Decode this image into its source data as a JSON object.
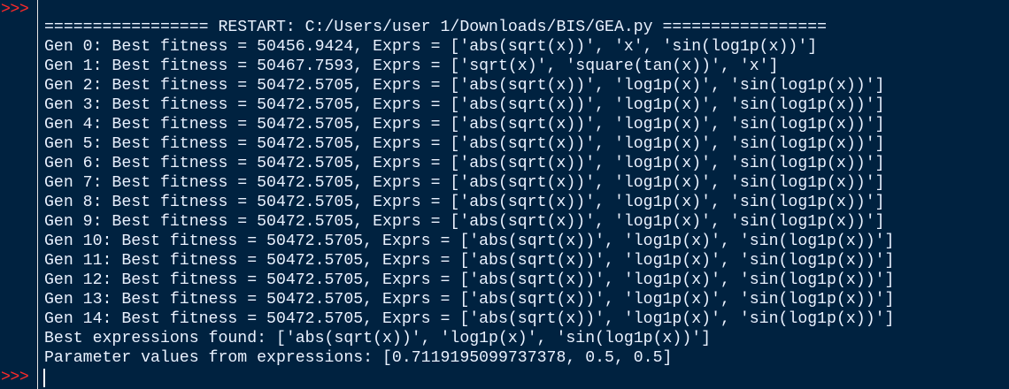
{
  "shell": {
    "prompt_symbol": ">>>",
    "output_lines": [
      "================= RESTART: C:/Users/user 1/Downloads/BIS/GEA.py =================",
      "Gen 0: Best fitness = 50456.9424, Exprs = ['abs(sqrt(x))', 'x', 'sin(log1p(x))']",
      "Gen 1: Best fitness = 50467.7593, Exprs = ['sqrt(x)', 'square(tan(x))', 'x']",
      "Gen 2: Best fitness = 50472.5705, Exprs = ['abs(sqrt(x))', 'log1p(x)', 'sin(log1p(x))']",
      "Gen 3: Best fitness = 50472.5705, Exprs = ['abs(sqrt(x))', 'log1p(x)', 'sin(log1p(x))']",
      "Gen 4: Best fitness = 50472.5705, Exprs = ['abs(sqrt(x))', 'log1p(x)', 'sin(log1p(x))']",
      "Gen 5: Best fitness = 50472.5705, Exprs = ['abs(sqrt(x))', 'log1p(x)', 'sin(log1p(x))']",
      "Gen 6: Best fitness = 50472.5705, Exprs = ['abs(sqrt(x))', 'log1p(x)', 'sin(log1p(x))']",
      "Gen 7: Best fitness = 50472.5705, Exprs = ['abs(sqrt(x))', 'log1p(x)', 'sin(log1p(x))']",
      "Gen 8: Best fitness = 50472.5705, Exprs = ['abs(sqrt(x))', 'log1p(x)', 'sin(log1p(x))']",
      "Gen 9: Best fitness = 50472.5705, Exprs = ['abs(sqrt(x))', 'log1p(x)', 'sin(log1p(x))']",
      "Gen 10: Best fitness = 50472.5705, Exprs = ['abs(sqrt(x))', 'log1p(x)', 'sin(log1p(x))']",
      "Gen 11: Best fitness = 50472.5705, Exprs = ['abs(sqrt(x))', 'log1p(x)', 'sin(log1p(x))']",
      "Gen 12: Best fitness = 50472.5705, Exprs = ['abs(sqrt(x))', 'log1p(x)', 'sin(log1p(x))']",
      "Gen 13: Best fitness = 50472.5705, Exprs = ['abs(sqrt(x))', 'log1p(x)', 'sin(log1p(x))']",
      "Gen 14: Best fitness = 50472.5705, Exprs = ['abs(sqrt(x))', 'log1p(x)', 'sin(log1p(x))']",
      "Best expressions found: ['abs(sqrt(x))', 'log1p(x)', 'sin(log1p(x))']",
      "Parameter values from expressions: [0.7119195099737378, 0.5, 0.5]"
    ],
    "input_value": ""
  },
  "colors": {
    "background": "#002240",
    "prompt": "#ff2a2a",
    "output_text": "#eaf2ff",
    "divider": "#e8e8e8"
  }
}
